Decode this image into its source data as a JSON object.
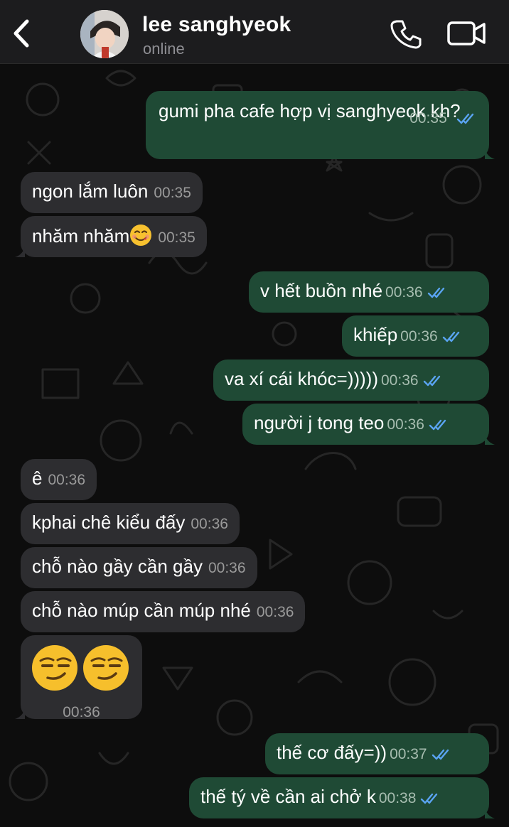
{
  "header": {
    "contact_name": "lee sanghyeok",
    "status": "online"
  },
  "messages": [
    {
      "dir": "out",
      "text": "gumi pha cafe hợp vị sanghyeok kh?",
      "time": "00:35",
      "ticks": "read"
    },
    {
      "dir": "in",
      "text": "ngon lắm luôn",
      "time": "00:35"
    },
    {
      "dir": "in",
      "text": "nhăm nhăm",
      "emoji": "yum-face",
      "time": "00:35"
    },
    {
      "dir": "out",
      "text": "v hết buồn nhé",
      "time": "00:36",
      "ticks": "read"
    },
    {
      "dir": "out",
      "text": "khiếp",
      "time": "00:36",
      "ticks": "read"
    },
    {
      "dir": "out",
      "text": "va xí cái khóc=)))))",
      "time": "00:36",
      "ticks": "read"
    },
    {
      "dir": "out",
      "text": "người j tong teo",
      "time": "00:36",
      "ticks": "read"
    },
    {
      "dir": "in",
      "text": "ê",
      "time": "00:36"
    },
    {
      "dir": "in",
      "text": "kphai chê kiểu đấy",
      "time": "00:36"
    },
    {
      "dir": "in",
      "text": "chỗ nào gầy cần gầy",
      "time": "00:36"
    },
    {
      "dir": "in",
      "text": "chỗ nào múp cần múp nhé",
      "time": "00:36"
    },
    {
      "dir": "in",
      "text": "",
      "emoji": "smirk-face x2",
      "time": "00:36"
    },
    {
      "dir": "out",
      "text": "thế cơ đấy=))",
      "time": "00:37",
      "ticks": "read"
    },
    {
      "dir": "out",
      "text": "thế tý về cần ai chở k",
      "time": "00:38",
      "ticks": "read"
    }
  ],
  "colors": {
    "background": "#0d0d0d",
    "header": "#1c1c1e",
    "incoming_bubble": "#2d2d30",
    "outgoing_bubble": "#1f4a35",
    "read_ticks": "#5aa4f2"
  },
  "icons": {
    "back": "chevron-left-icon",
    "call": "phone-icon",
    "video": "video-camera-icon",
    "read_receipt": "double-check-icon"
  }
}
